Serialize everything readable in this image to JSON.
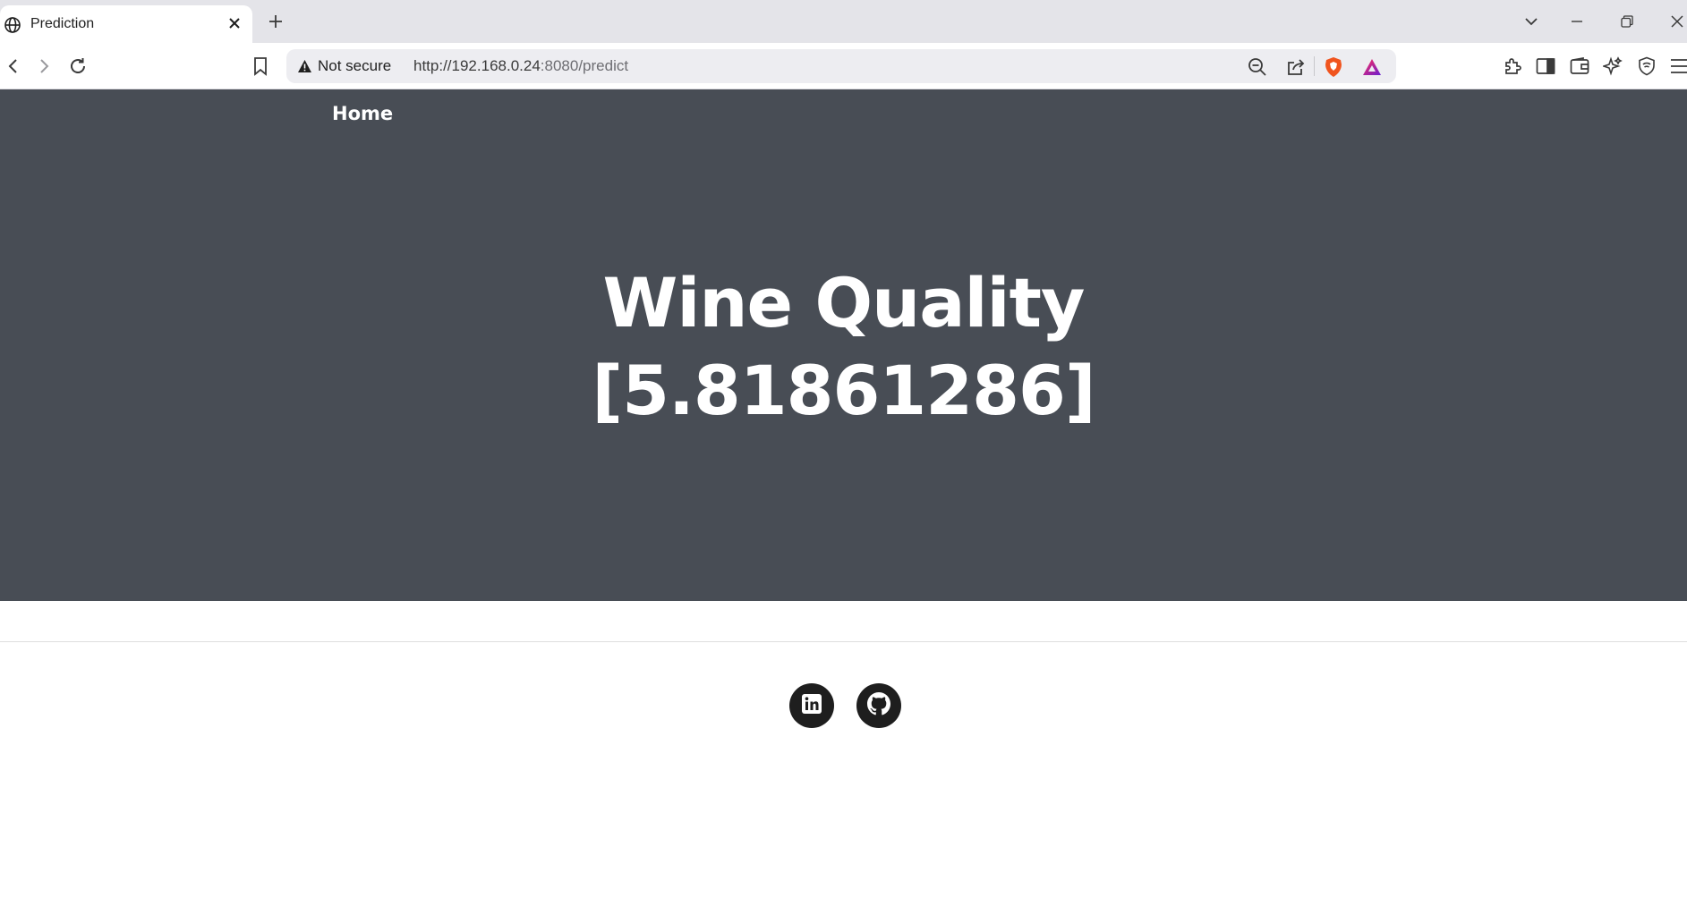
{
  "browser": {
    "tab": {
      "title": "Prediction"
    },
    "address": {
      "security_label": "Not secure",
      "url_host": "http://192.168.0.24",
      "url_rest": ":8080/predict"
    }
  },
  "page": {
    "nav": {
      "home_label": "Home"
    },
    "hero": {
      "title": "Wine Quality",
      "prediction": "[5.81861286]"
    },
    "footer": {
      "social_links": [
        {
          "icon": "linkedin-icon"
        },
        {
          "icon": "github-icon"
        }
      ]
    }
  },
  "colors": {
    "hero_bg": "#484d55",
    "text_on_hero": "#ffffff",
    "social_bg": "#1e1e1e"
  }
}
